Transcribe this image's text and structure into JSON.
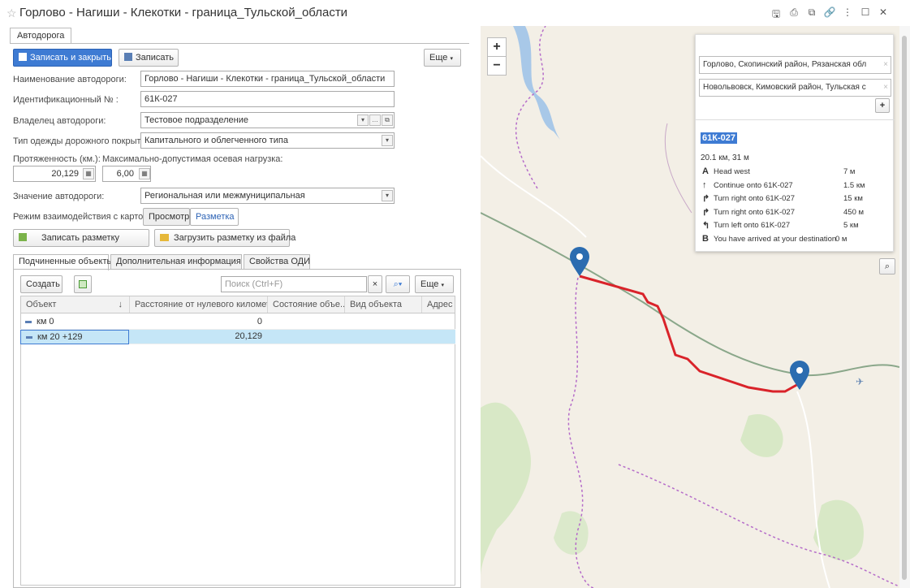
{
  "window": {
    "title": "Горлово - Нагиши - Клекотки - граница_Тульской_области",
    "star_icon": "star-icon",
    "buttons": [
      "save-icon",
      "print-icon",
      "preview-icon",
      "link-icon",
      "more-icon",
      "maximize-icon",
      "close-icon"
    ]
  },
  "form": {
    "tab_label": "Автодорога",
    "toolbar": {
      "save_close_label": "Записать и закрыть",
      "save_label": "Записать",
      "more_label": "Еще"
    },
    "fields": {
      "name_label": "Наименование автодороги:",
      "name_value": "Горлово - Нагиши - Клекотки - граница_Тульской_области",
      "id_label": "Идентификационный № :",
      "id_value": "61К-027",
      "owner_label": "Владелец автодороги:",
      "owner_value": "Тестовое подразделение",
      "surface_label": "Тип одежды дорожного покрытия:",
      "surface_value": "Капитального и облегченного типа",
      "length_label": "Протяженность (км.):",
      "length_value": "20,129",
      "load_label": "Максимально-допустимая осевая нагрузка:",
      "load_value": "6,00",
      "significance_label": "Значение автодороги:",
      "significance_value": "Региональная или межмуниципальная",
      "map_mode_label": "Режим взаимодействия с картой:",
      "map_mode_view": "Просмотр",
      "map_mode_markup": "Разметка"
    },
    "actions": {
      "save_markup_label": "Записать разметку",
      "load_markup_label": "Загрузить разметку из файла"
    },
    "subtabs": [
      "Подчиненные объекты",
      "Дополнительная информация",
      "Свойства ОДИ"
    ],
    "grid_toolbar": {
      "create_label": "Создать",
      "search_placeholder": "Поиск (Ctrl+F)",
      "more_label": "Еще"
    },
    "grid": {
      "columns": [
        "Объект",
        "Расстояние от нулевого километра",
        "Состояние объе...",
        "Вид объекта",
        "Адрес"
      ],
      "sort_indicator": "↓",
      "rows": [
        {
          "object": "км 0",
          "distance": "0"
        },
        {
          "object": "км 20 +129",
          "distance": "20,129"
        }
      ]
    }
  },
  "map": {
    "zoom_in": "+",
    "zoom_out": "−",
    "search_icon": "search-icon",
    "route": {
      "from": "Горлово, Скопинский район, Рязанская обл",
      "to": "Новольвовск, Кимовский район, Тульская с",
      "add_waypoint": "+",
      "road_name": "61К-027",
      "summary": "20.1 км, 31 м",
      "steps": [
        {
          "icon": "A",
          "text": "Head west",
          "dist": "7 м"
        },
        {
          "icon": "↑",
          "text": "Continue onto 61K-027",
          "dist": "1.5 км"
        },
        {
          "icon": "↱",
          "text": "Turn right onto 61K-027",
          "dist": "15 км"
        },
        {
          "icon": "↱",
          "text": "Turn right onto 61K-027",
          "dist": "450 м"
        },
        {
          "icon": "↰",
          "text": "Turn left onto 61K-027",
          "dist": "5 км"
        },
        {
          "icon": "B",
          "text": "You have arrived at your destination",
          "dist": "0 м"
        }
      ]
    },
    "colors": {
      "route": "#d9232a",
      "marker": "#2b6cb0",
      "boundary": "#b56cc9",
      "water": "#a8c8e8",
      "forest": "#d4e6c2"
    }
  }
}
